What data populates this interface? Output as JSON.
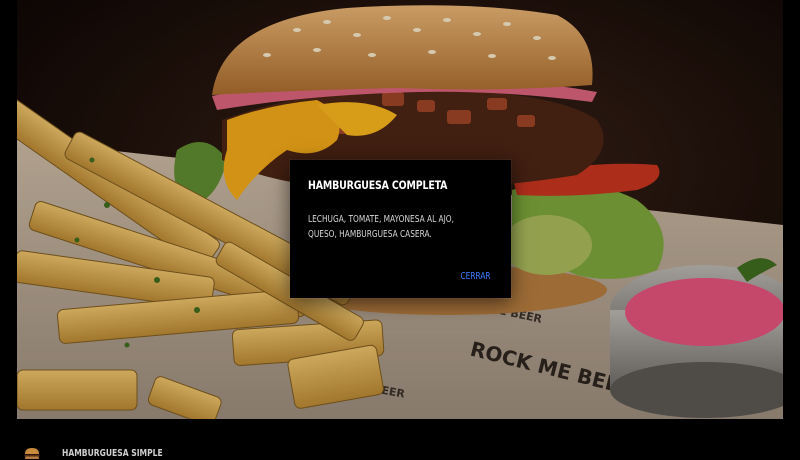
{
  "hero": {
    "image_label": "burger-and-fries-photo",
    "paper_brand_text": "ROCK ME BEER"
  },
  "modal": {
    "title": "HAMBURGUESA COMPLETA",
    "description": "LECHUGA, TOMATE, MAYONESA AL AJO, QUESO, HAMBURGUESA CASERA.",
    "close_label": "CERRAR",
    "accent_color": "#3f7bff"
  },
  "menu": {
    "items": [
      {
        "label": "HAMBURGUESA SIMPLE",
        "icon": "burger-icon"
      }
    ]
  }
}
